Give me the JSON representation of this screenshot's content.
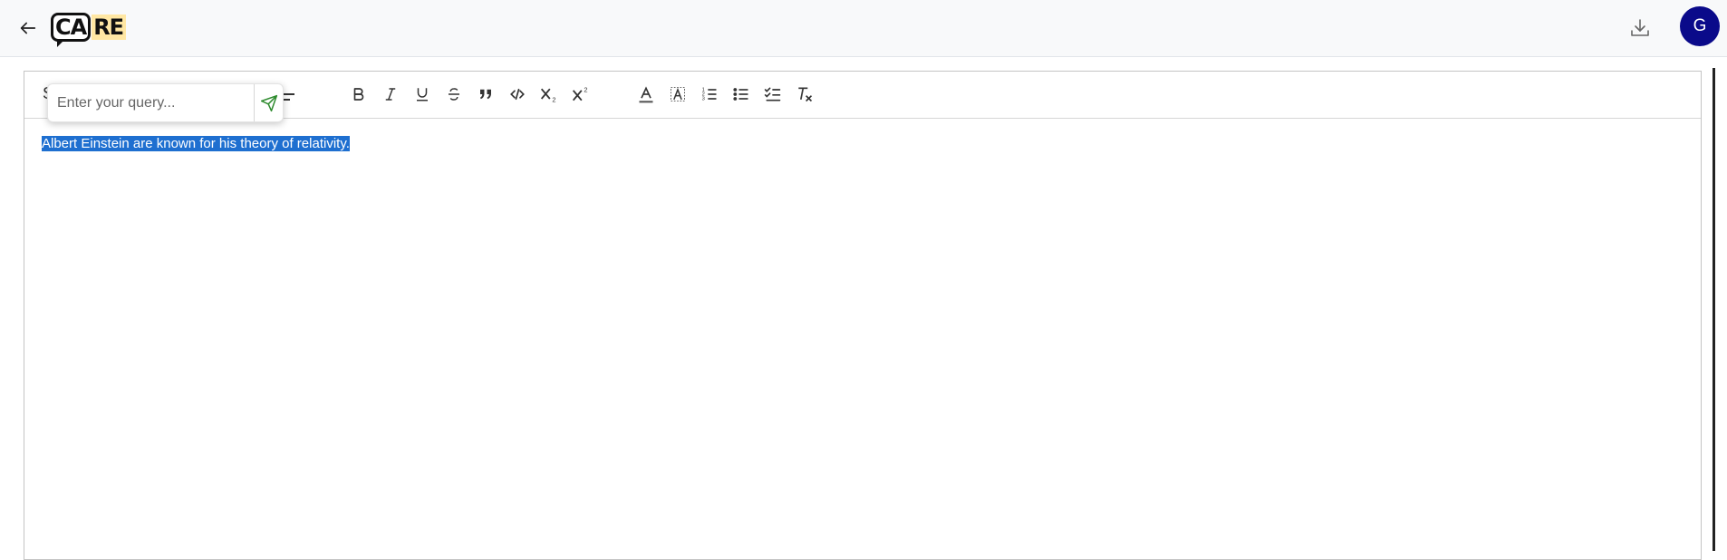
{
  "header": {
    "logo_left": "CA",
    "logo_right": "RE",
    "avatar_initial": "G",
    "icons": {
      "back": "arrow-left-icon",
      "download": "download-icon"
    }
  },
  "toolbar": {
    "partial_label": "S",
    "buttons": [
      {
        "name": "bold",
        "icon": "bold-icon"
      },
      {
        "name": "italic",
        "icon": "italic-icon"
      },
      {
        "name": "underline",
        "icon": "underline-icon"
      },
      {
        "name": "strikethrough",
        "icon": "strikethrough-icon"
      },
      {
        "name": "blockquote",
        "icon": "quote-icon"
      },
      {
        "name": "code",
        "icon": "code-icon"
      },
      {
        "name": "subscript",
        "icon": "subscript-icon"
      },
      {
        "name": "superscript",
        "icon": "superscript-icon"
      },
      {
        "name": "text-color",
        "icon": "text-color-icon"
      },
      {
        "name": "highlight",
        "icon": "highlight-icon"
      },
      {
        "name": "ordered-list",
        "icon": "ordered-list-icon"
      },
      {
        "name": "bullet-list",
        "icon": "bullet-list-icon"
      },
      {
        "name": "checklist",
        "icon": "checklist-icon"
      },
      {
        "name": "clear-format",
        "icon": "clear-format-icon"
      }
    ]
  },
  "query_popup": {
    "placeholder": "Enter your query...",
    "value": ""
  },
  "document": {
    "selected_text": "Albert Einstein are known for his theory of relativity."
  },
  "colors": {
    "avatar_bg": "#0a0a8a",
    "selection": "#1e6fd0",
    "logo_highlight": "#ffe7a3",
    "send_icon": "#2e8b2e"
  }
}
